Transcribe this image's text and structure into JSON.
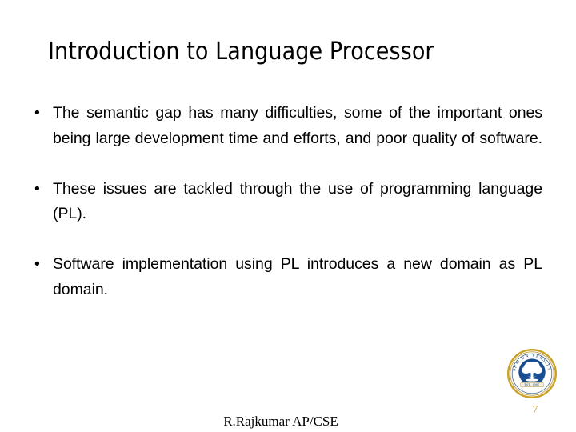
{
  "slide": {
    "title": "Introduction to Language Processor",
    "bullets": [
      {
        "marker": "•",
        "text": "The semantic gap has many difficulties, some of the important ones being large development time and efforts, and poor quality of software."
      },
      {
        "marker": "•",
        "text": "These issues are tackled through the use of programming language (PL)."
      },
      {
        "marker": "•",
        "text": "Software implementation using PL introduces a new domain as PL domain."
      }
    ],
    "footer": "R.Rajkumar AP/CSE",
    "page_number": "7",
    "logo": {
      "name": "university-seal-logo",
      "ring_color": "#c9a227",
      "disc_color": "#1a4d8f",
      "tree_color": "#ffffff",
      "banner_color": "#f2efe4"
    },
    "colors": {
      "background": "#ffffff",
      "text": "#000000",
      "page_number": "#b99640"
    }
  }
}
